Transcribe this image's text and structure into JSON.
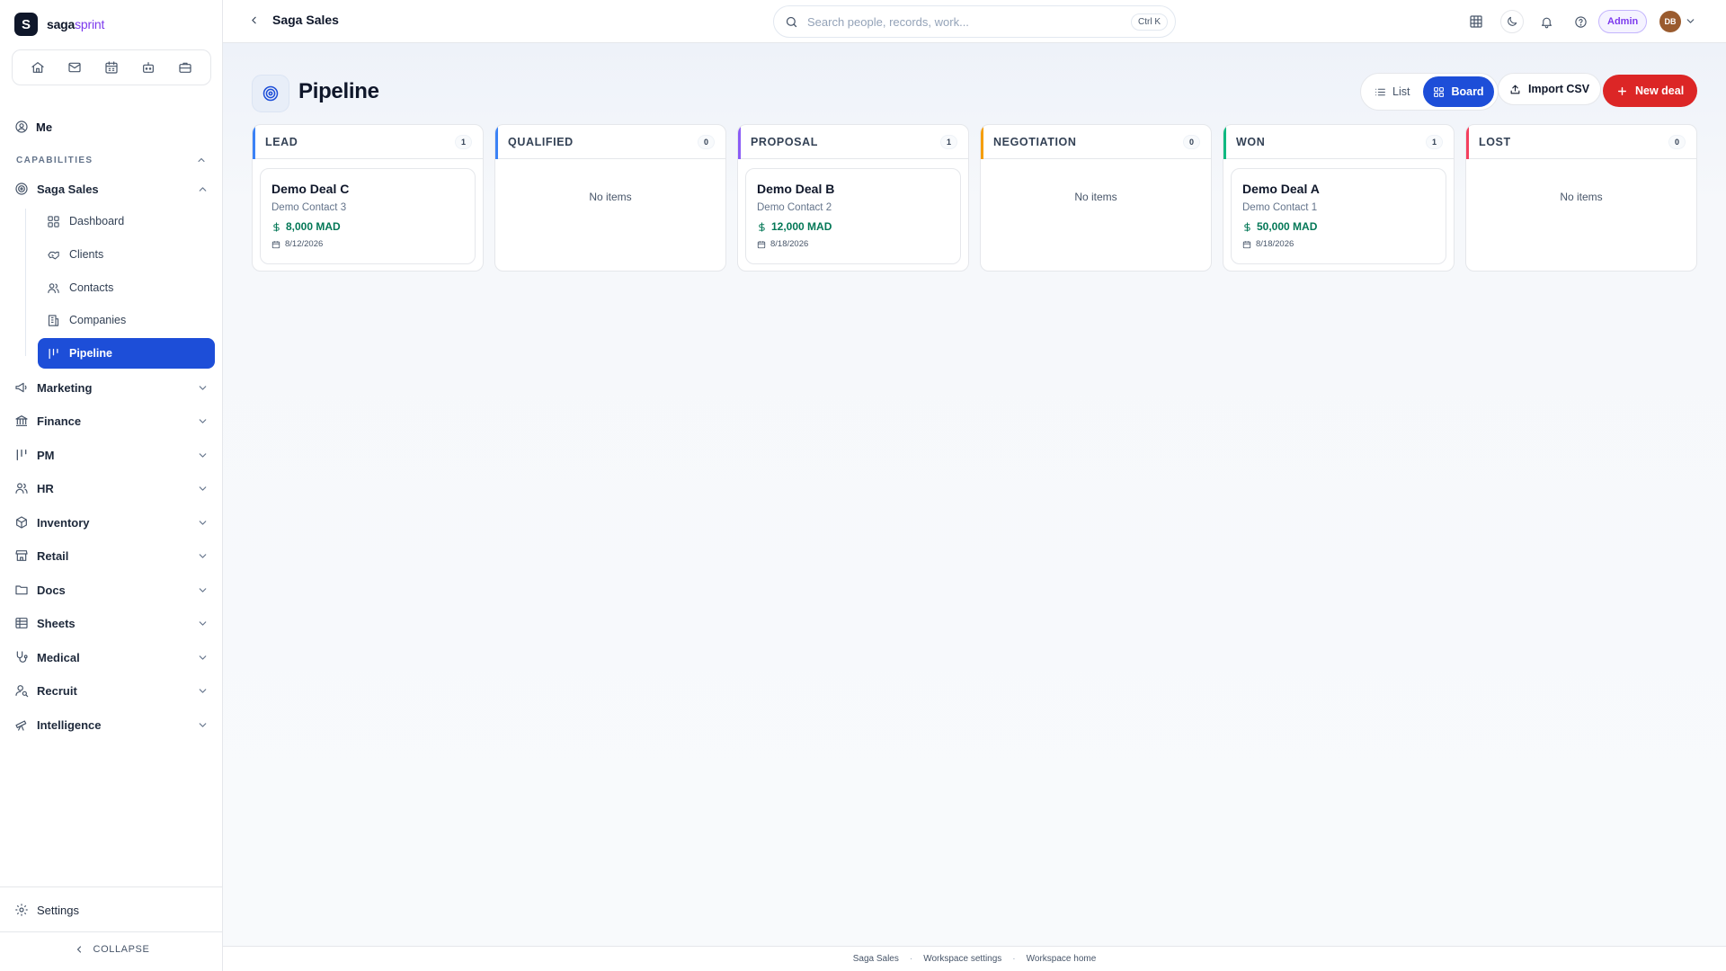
{
  "brand": {
    "logo_letter": "S",
    "name_part1": "saga",
    "name_part2": "sprint"
  },
  "quickbar": {
    "icons": [
      "home-icon",
      "mail-icon",
      "calendar-icon",
      "robot-icon",
      "briefcase-icon"
    ]
  },
  "sidebar": {
    "me": "Me",
    "capabilities_label": "CAPABILITIES",
    "active_section": "Saga Sales",
    "sub_items": [
      {
        "label": "Dashboard",
        "icon": "dashboard-icon"
      },
      {
        "label": "Clients",
        "icon": "clients-icon"
      },
      {
        "label": "Contacts",
        "icon": "contacts-icon"
      },
      {
        "label": "Companies",
        "icon": "companies-icon"
      },
      {
        "label": "Pipeline",
        "icon": "pipeline-icon",
        "active": true
      }
    ],
    "sections": [
      {
        "label": "Marketing",
        "icon": "megaphone-icon"
      },
      {
        "label": "Finance",
        "icon": "bank-icon"
      },
      {
        "label": "PM",
        "icon": "pm-icon"
      },
      {
        "label": "HR",
        "icon": "people-icon"
      },
      {
        "label": "Inventory",
        "icon": "box-icon"
      },
      {
        "label": "Retail",
        "icon": "store-icon"
      },
      {
        "label": "Docs",
        "icon": "folder-icon"
      },
      {
        "label": "Sheets",
        "icon": "table-icon"
      },
      {
        "label": "Medical",
        "icon": "stethoscope-icon"
      },
      {
        "label": "Recruit",
        "icon": "recruit-icon"
      },
      {
        "label": "Intelligence",
        "icon": "telescope-icon"
      }
    ],
    "settings": "Settings",
    "collapse": "COLLAPSE"
  },
  "topbar": {
    "breadcrumb": "Saga Sales",
    "search_placeholder": "Search people, records, work...",
    "search_shortcut": "Ctrl K",
    "admin_badge": "Admin",
    "avatar_initials": "DB"
  },
  "page": {
    "title": "Pipeline",
    "view_list": "List",
    "view_board": "Board",
    "import_label": "Import CSV",
    "new_label": "New deal",
    "empty_text": "No items"
  },
  "colors": {
    "primary": "#1d4ed8",
    "danger": "#dc2626",
    "money": "#047857",
    "stage_lead": "#3b82f6",
    "stage_qualified": "#3b82f6",
    "stage_proposal": "#8b5cf6",
    "stage_negotiation": "#f59e0b",
    "stage_won": "#10b981",
    "stage_lost": "#f43f5e"
  },
  "columns": [
    {
      "title": "LEAD",
      "count": "1",
      "deal": {
        "title": "Demo Deal C",
        "contact": "Demo Contact 3",
        "amount": "8,000 MAD",
        "date": "8/12/2026"
      }
    },
    {
      "title": "QUALIFIED",
      "count": "0"
    },
    {
      "title": "PROPOSAL",
      "count": "1",
      "deal": {
        "title": "Demo Deal B",
        "contact": "Demo Contact 2",
        "amount": "12,000 MAD",
        "date": "8/18/2026"
      }
    },
    {
      "title": "NEGOTIATION",
      "count": "0"
    },
    {
      "title": "WON",
      "count": "1",
      "deal": {
        "title": "Demo Deal A",
        "contact": "Demo Contact 1",
        "amount": "50,000 MAD",
        "date": "8/18/2026"
      }
    },
    {
      "title": "LOST",
      "count": "0"
    }
  ],
  "footer": {
    "links": [
      "Saga Sales",
      "Workspace settings",
      "Workspace home"
    ]
  }
}
